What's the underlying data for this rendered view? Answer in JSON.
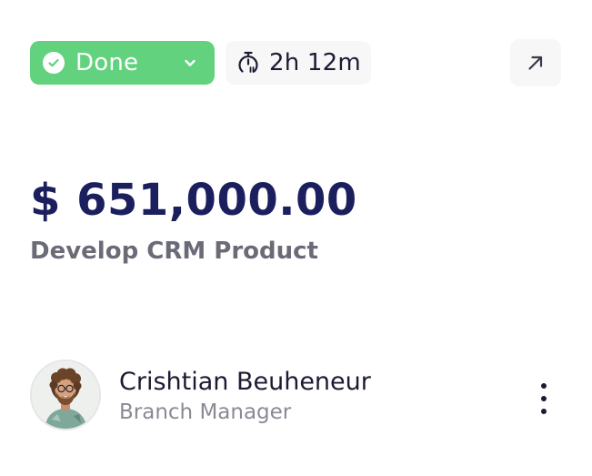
{
  "status": {
    "label": "Done",
    "color": "#62d27e",
    "icons": [
      "check-circle-icon",
      "chevron-down-icon"
    ]
  },
  "timer": {
    "value": "2h 12m",
    "icon": "stopwatch-icon"
  },
  "open_button": {
    "icon": "arrow-up-right-icon"
  },
  "deal": {
    "amount": "$ 651,000.00",
    "title": "Develop CRM Product"
  },
  "assignee": {
    "name": "Crishtian Beuheneur",
    "role": "Branch Manager"
  },
  "menu": {
    "icon": "more-vertical-icon"
  },
  "colors": {
    "amount": "#1b1f5e",
    "muted_text": "#6b6b78",
    "chip_background": "#f7f7f8"
  }
}
